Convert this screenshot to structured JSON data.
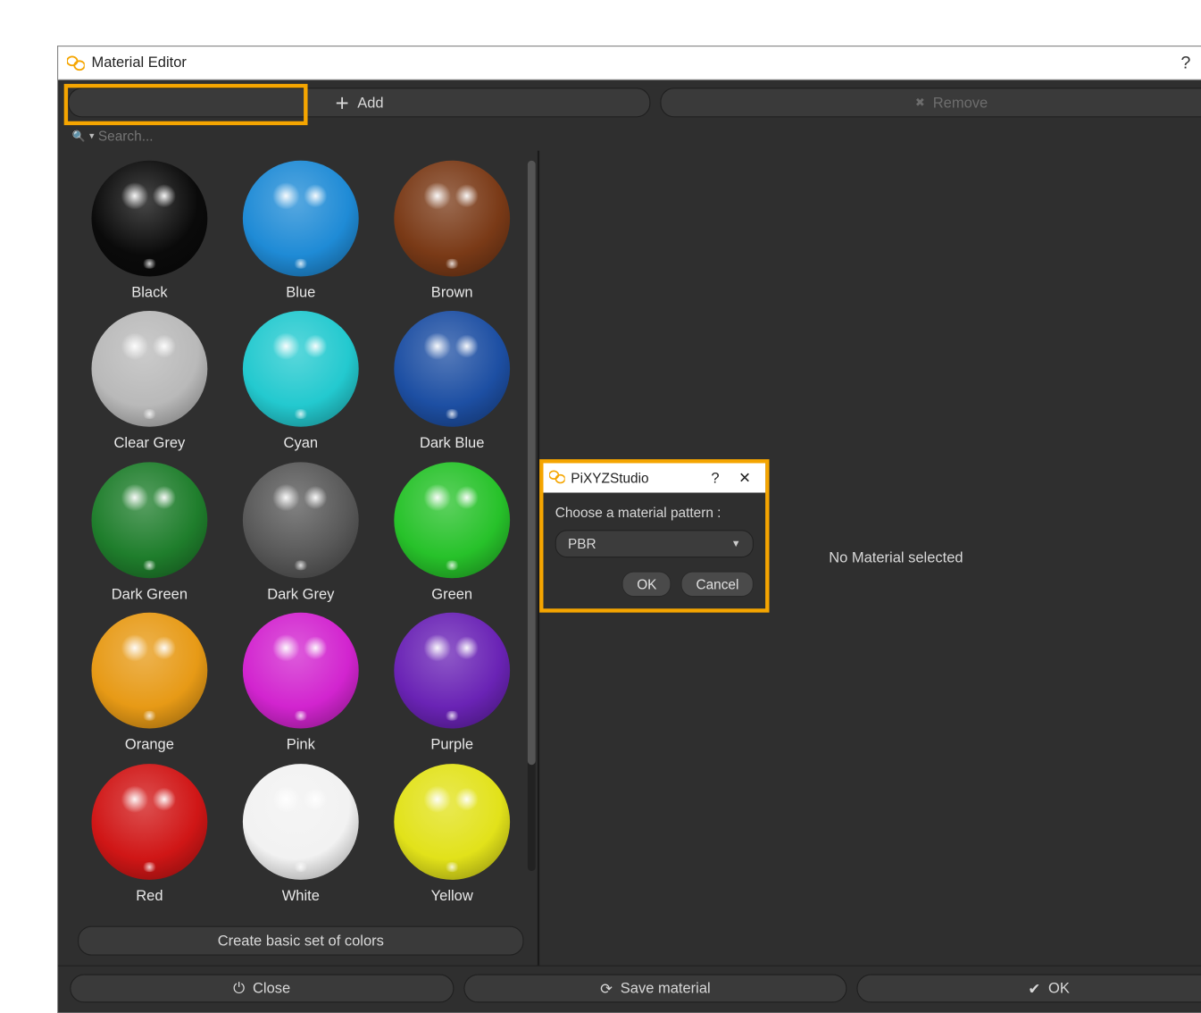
{
  "window": {
    "title": "Material Editor",
    "help_label": "?",
    "close_label": "✕"
  },
  "toolbar": {
    "add_label": "Add",
    "remove_label": "Remove"
  },
  "search": {
    "placeholder": "Search...",
    "value": ""
  },
  "materials": [
    {
      "name": "Black",
      "color": "#0a0a0a"
    },
    {
      "name": "Blue",
      "color": "#1f8bd6"
    },
    {
      "name": "Brown",
      "color": "#7a3a17"
    },
    {
      "name": "Clear Grey",
      "color": "#b9b9b9"
    },
    {
      "name": "Cyan",
      "color": "#23c9cf"
    },
    {
      "name": "Dark Blue",
      "color": "#1d4fa3"
    },
    {
      "name": "Dark Green",
      "color": "#1f7e2c"
    },
    {
      "name": "Dark Grey",
      "color": "#585858"
    },
    {
      "name": "Green",
      "color": "#27c22a"
    },
    {
      "name": "Orange",
      "color": "#e79a16"
    },
    {
      "name": "Pink",
      "color": "#d224cf"
    },
    {
      "name": "Purple",
      "color": "#6a23b5"
    },
    {
      "name": "Red",
      "color": "#d01616"
    },
    {
      "name": "White",
      "color": "#f2f2f2"
    },
    {
      "name": "Yellow",
      "color": "#e2e21a"
    }
  ],
  "left_footer": {
    "create_label": "Create basic set of colors"
  },
  "right_pane": {
    "empty_label": "No Material selected"
  },
  "footer": {
    "close_label": "Close",
    "save_label": "Save material",
    "ok_label": "OK"
  },
  "dialog": {
    "title": "PiXYZStudio",
    "help_label": "?",
    "close_label": "✕",
    "prompt": "Choose a material pattern :",
    "selected_value": "PBR",
    "ok_label": "OK",
    "cancel_label": "Cancel"
  },
  "icons": {
    "plus": "＋",
    "remove": "✖",
    "power": "⏻",
    "refresh": "⟳",
    "check": "✔",
    "search": "🔍",
    "dropdown_arrow": "▾",
    "caret": "▼"
  },
  "accent": "#f5a500"
}
